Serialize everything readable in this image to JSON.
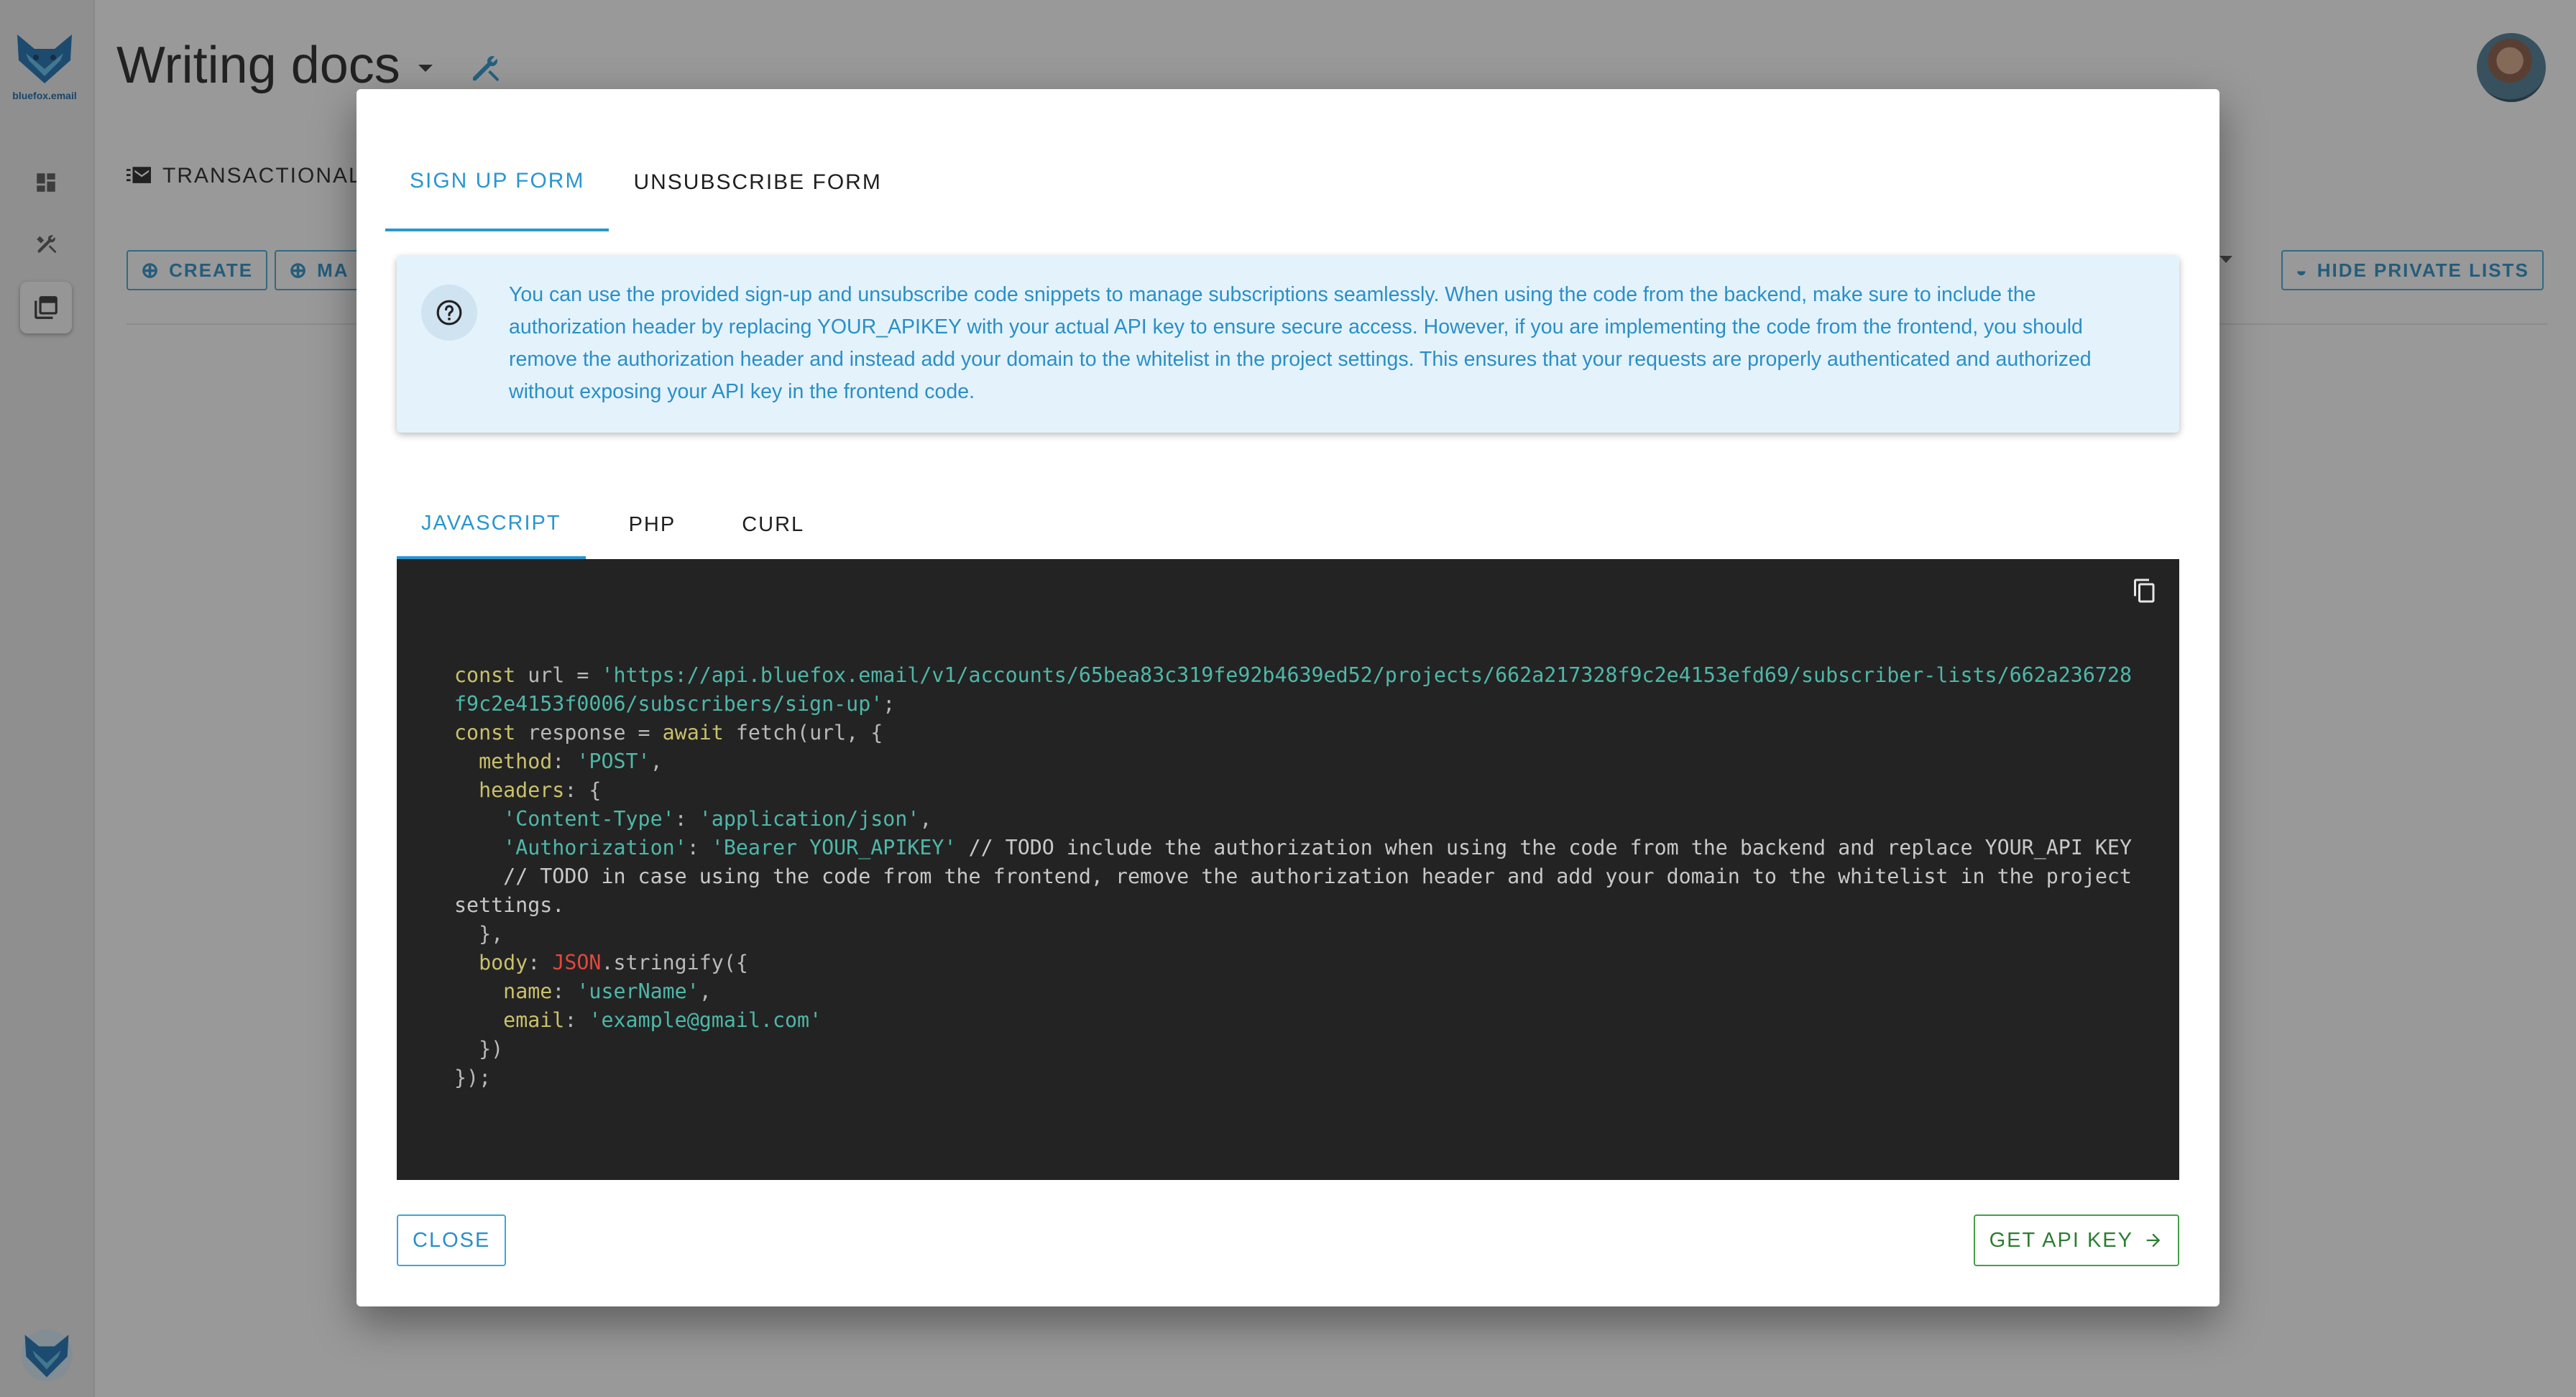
{
  "app": {
    "logo_text": "bluefox.email",
    "page_title": "Writing docs"
  },
  "background": {
    "tab_label": "TRANSACTIONAL",
    "create_label": "CREATE",
    "manage_label": "MA",
    "hide_private_label": "HIDE PRIVATE LISTS"
  },
  "modal": {
    "tabs": [
      {
        "label": "SIGN UP FORM",
        "active": true
      },
      {
        "label": "UNSUBSCRIBE FORM",
        "active": false
      }
    ],
    "info_text": "You can use the provided sign-up and unsubscribe code snippets to manage subscriptions seamlessly. When using the code from the backend, make sure to include the authorization header by replacing YOUR_APIKEY with your actual API key to ensure secure access. However, if you are implementing the code from the frontend, you should remove the authorization header and instead add your domain to the whitelist in the project settings. This ensures that your requests are properly authenticated and authorized without exposing your API key in the frontend code.",
    "lang_tabs": [
      {
        "label": "JAVASCRIPT",
        "active": true
      },
      {
        "label": "PHP",
        "active": false
      },
      {
        "label": "CURL",
        "active": false
      }
    ],
    "code": {
      "url": "'https://api.bluefox.email/v1/accounts/65bea83c319fe92b4639ed52/projects/662a217328f9c2e4153efd69/subscriber-lists/662a236728f9c2e4153f0006/subscribers/sign-up'",
      "method_value": "'POST'",
      "content_type_key": "'Content-Type'",
      "content_type_value": "'application/json'",
      "authorization_key": "'Authorization'",
      "authorization_value": "'Bearer YOUR_APIKEY'",
      "comment_backend": "// TODO include the authorization when using the code from the backend and replace YOUR_API KEY",
      "comment_frontend": "// TODO in case using the code from the frontend, remove the authorization header and add your domain to the whitelist in the project settings.",
      "name_value": "'userName'",
      "email_value": "'example@gmail.com'"
    },
    "close_label": "CLOSE",
    "get_api_key_label": "GET API KEY"
  },
  "colors": {
    "accent": "#2996d0",
    "code_bg": "#232323",
    "keyword": "#c9c06b",
    "string": "#4fb7a8",
    "json": "#e0483e",
    "success": "#2e7d32"
  }
}
